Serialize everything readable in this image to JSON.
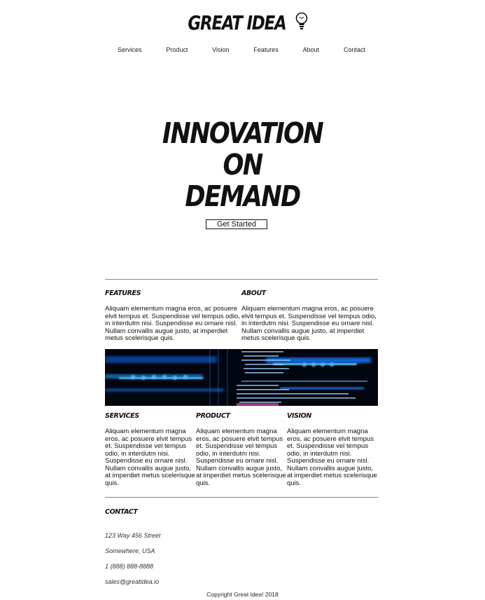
{
  "brand": {
    "name": "GREAT IDEA"
  },
  "nav": {
    "items": [
      "Services",
      "Product",
      "Vision",
      "Features",
      "About",
      "Contact"
    ]
  },
  "hero": {
    "lines": [
      "INNOVATION",
      "ON",
      "DEMAND"
    ],
    "cta_label": "Get Started"
  },
  "features": {
    "title": "FEATURES",
    "text": "Aliquam elementum magna eros, ac posuere elvit tempus et. Suspendisse vel tempus odio, in interdutm nisi. Suspendisse eu ornare nisl. Nullam convallis augue justo, at imperdiet metus scelerisque quis."
  },
  "about": {
    "title": "ABOUT",
    "text": "Aliquam elementum magna eros, ac posuere elvit tempus et. Suspendisse vel tempus odio, in interdutm nisi. Suspendisse eu ornare nisl. Nullam convallis augue justo, at imperdiet metus scelerisque quis."
  },
  "services": {
    "title": "SERVICES",
    "text": "Aliquam elementum magna eros, ac posuere elvit tempus et. Suspendisse vel tempus odio, in interdutm nisi. Suspendisse eu ornare nisl. Nullam convallis augue justo, at imperdiet metus scelerisque quis."
  },
  "product": {
    "title": "PRODUCT",
    "text": "Aliquam elementum magna eros, ac posuere elvit tempus et. Suspendisse vel tempus odio, in interdutm nisi. Suspendisse eu ornare nisl. Nullam convallis augue justo, at imperdiet metus scelerisque quis."
  },
  "vision": {
    "title": "VISION",
    "text": "Aliquam elementum magna eros, ac posuere elvit tempus et. Suspendisse vel tempus odio, in interdutm nisi. Suspendisse eu ornare nisl. Nullam convallis augue justo, at imperdiet metus scelerisque quis."
  },
  "contact": {
    "title": "CONTACT",
    "address1": "123 Way 456 Street",
    "address2": "Somewhere, USA",
    "phone": "1 (888) 888-8888",
    "email": "sales@greatidea.io"
  },
  "footer": {
    "copyright": "Copyright Great Idea! 2018"
  },
  "colors": {
    "text": "#111111",
    "rule": "#888888",
    "banner_bg": "#020611",
    "banner_accent": "#1e90ff"
  }
}
